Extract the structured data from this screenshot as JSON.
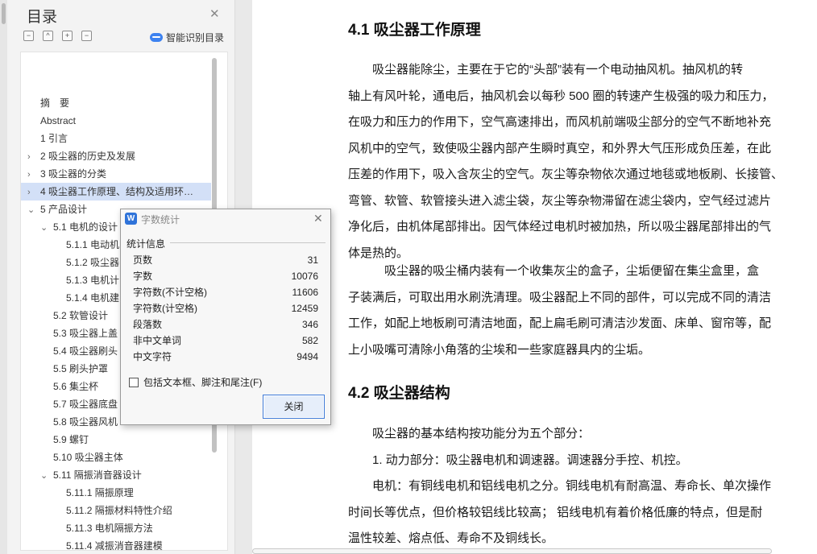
{
  "toc": {
    "title": "目录",
    "smart_label": "智能识别目录",
    "tool_icons": [
      "−",
      "^",
      "+",
      "−"
    ],
    "items": [
      {
        "label": "摘　要",
        "chevron": "",
        "indent": 0
      },
      {
        "label": "Abstract",
        "chevron": "",
        "indent": 0
      },
      {
        "label": "1 引言",
        "chevron": "",
        "indent": 0
      },
      {
        "label": "2 吸尘器的历史及发展",
        "chevron": "›",
        "indent": 0
      },
      {
        "label": "3 吸尘器的分类",
        "chevron": "›",
        "indent": 0
      },
      {
        "label": "4 吸尘器工作原理、结构及适用环…",
        "chevron": "›",
        "indent": 0,
        "selected": true
      },
      {
        "label": "5 产品设计",
        "chevron": "⌄",
        "indent": 0
      },
      {
        "label": "5.1 电机的设计",
        "chevron": "⌄",
        "indent": 1
      },
      {
        "label": "5.1.1 电动机",
        "chevron": "",
        "indent": 2
      },
      {
        "label": "5.1.2 吸尘器",
        "chevron": "",
        "indent": 2
      },
      {
        "label": "5.1.3 电机计",
        "chevron": "",
        "indent": 2
      },
      {
        "label": "5.1.4 电机建",
        "chevron": "",
        "indent": 2
      },
      {
        "label": "5.2 软管设计",
        "chevron": "",
        "indent": 1
      },
      {
        "label": "5.3 吸尘器上盖",
        "chevron": "",
        "indent": 1
      },
      {
        "label": "5.4 吸尘器刷头",
        "chevron": "",
        "indent": 1
      },
      {
        "label": "5.5 刷头护罩",
        "chevron": "",
        "indent": 1
      },
      {
        "label": "5.6 集尘杯",
        "chevron": "",
        "indent": 1
      },
      {
        "label": "5.7 吸尘器底盘",
        "chevron": "",
        "indent": 1
      },
      {
        "label": "5.8 吸尘器风机",
        "chevron": "",
        "indent": 1
      },
      {
        "label": "5.9 螺钉",
        "chevron": "",
        "indent": 1
      },
      {
        "label": "5.10 吸尘器主体",
        "chevron": "",
        "indent": 1
      },
      {
        "label": "5.11 隔振消音器设计",
        "chevron": "⌄",
        "indent": 1
      },
      {
        "label": "5.11.1 隔振原理",
        "chevron": "",
        "indent": 2
      },
      {
        "label": "5.11.2 隔振材料特性介绍",
        "chevron": "",
        "indent": 2
      },
      {
        "label": "5.11.3 电机隔振方法",
        "chevron": "",
        "indent": 2
      },
      {
        "label": "5.11.4 减振消音器建模",
        "chevron": "",
        "indent": 2
      }
    ]
  },
  "document": {
    "heading1": "4.1  吸尘器工作原理",
    "para1": [
      "　　吸尘器能除尘，主要在于它的“头部”装有一个电动抽风机。抽风机的转",
      "轴上有风叶轮，通电后，抽风机会以每秒 500 圈的转速产生极强的吸力和压力，",
      "在吸力和压力的作用下，空气高速排出，而风机前端吸尘部分的空气不断地补充",
      "风机中的空气，致使吸尘器内部产生瞬时真空，和外界大气压形成负压差，在此",
      "压差的作用下，吸入含灰尘的空气。灰尘等杂物依次通过地毯或地板刷、长接管、",
      "弯管、软管、软管接头进入滤尘袋，灰尘等杂物滞留在滤尘袋内，空气经过滤片",
      "净化后，由机体尾部排出。因气体经过电机时被加热，所以吸尘器尾部排出的气",
      "体是热的。"
    ],
    "para2": [
      "　　　吸尘器的吸尘桶内装有一个收集灰尘的盒子，尘垢便留在集尘盒里，盒",
      "子装满后，可取出用水刷洗清理。吸尘器配上不同的部件，可以完成不同的清洁",
      "工作，如配上地板刷可清洁地面，配上扁毛刷可清洁沙发面、床单、窗帘等，配",
      "上小吸嘴可清除小角落的尘埃和一些家庭器具内的尘垢。"
    ],
    "heading2": "4.2  吸尘器结构",
    "para3": [
      "　　吸尘器的基本结构按功能分为五个部分：",
      "　　1. 动力部分：吸尘器电机和调速器。调速器分手控、机控。",
      "　　电机：有铜线电机和铝线电机之分。铜线电机有耐高温、寿命长、单次操作",
      "时间长等优点，但价格较铝线比较高；  铝线电机有着价格低廉的特点，但是耐",
      "温性较差、熔点低、寿命不及铜线长。"
    ]
  },
  "dialog": {
    "icon_glyph": "W",
    "title": "字数统计",
    "group_label": "统计信息",
    "stats": [
      {
        "label": "页数",
        "value": "31"
      },
      {
        "label": "字数",
        "value": "10076"
      },
      {
        "label": "字符数(不计空格)",
        "value": "11606"
      },
      {
        "label": "字符数(计空格)",
        "value": "12459"
      },
      {
        "label": "段落数",
        "value": "346"
      },
      {
        "label": "非中文单词",
        "value": "582"
      },
      {
        "label": "中文字符",
        "value": "9494"
      }
    ],
    "checkbox_label": "包括文本框、脚注和尾注(F)",
    "checkbox_checked": false,
    "close_label": "关闭"
  }
}
